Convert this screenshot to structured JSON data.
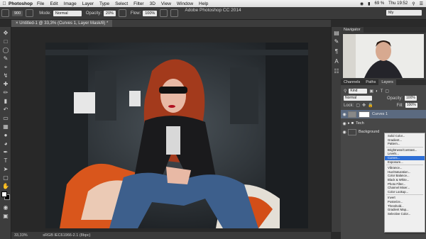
{
  "menubar": {
    "app": "Photoshop",
    "items": [
      "File",
      "Edit",
      "Image",
      "Layer",
      "Type",
      "Select",
      "Filter",
      "3D",
      "View",
      "Window",
      "Help"
    ],
    "battery": "69 %",
    "clock": "Thu 19:52"
  },
  "window_title": "Adobe Photoshop CC 2014",
  "options": {
    "brush_size": "900",
    "mode_label": "Mode:",
    "mode_value": "Normal",
    "opacity_label": "Opacity:",
    "opacity_value": "20%",
    "flow_label": "Flow:",
    "flow_value": "100%",
    "workspace": "My"
  },
  "document": {
    "tab_title": "Untitled-1 @ 33,3% (Curves 1, Layer Mask/8) *",
    "zoom": "33,33%",
    "profile": "sRGB IEC61966-2.1 (8bpc)"
  },
  "navigator": {
    "tab": "Navigator"
  },
  "layers_panel": {
    "tabs": [
      "Channels",
      "Paths",
      "Layers"
    ],
    "kind": "Kind",
    "blend_mode": "Normal",
    "opacity_label": "Opacity:",
    "opacity_value": "100%",
    "lock_label": "Lock:",
    "fill_label": "Fill:",
    "fill_value": "100%",
    "layers": [
      {
        "name": "Curves 1",
        "selected": true
      },
      {
        "name": "Tech",
        "selected": false
      },
      {
        "name": "Background",
        "selected": false
      }
    ]
  },
  "context_menu": {
    "groups": [
      [
        "Solid Color...",
        "Gradient...",
        "Pattern..."
      ],
      [
        "Brightness/Contrast...",
        "Levels...",
        "Curves...",
        "Exposure..."
      ],
      [
        "Vibrance...",
        "Hue/Saturation...",
        "Color Balance...",
        "Black & White...",
        "Photo Filter...",
        "Channel Mixer...",
        "Color Lookup..."
      ],
      [
        "Invert",
        "Posterize...",
        "Threshold...",
        "Gradient Map...",
        "Selective Color..."
      ]
    ],
    "highlighted": "Curves..."
  },
  "colors": {
    "accent_selection": "#2e6fd6",
    "layer_selected": "#5b6a80",
    "hair": "#a33a1c"
  }
}
